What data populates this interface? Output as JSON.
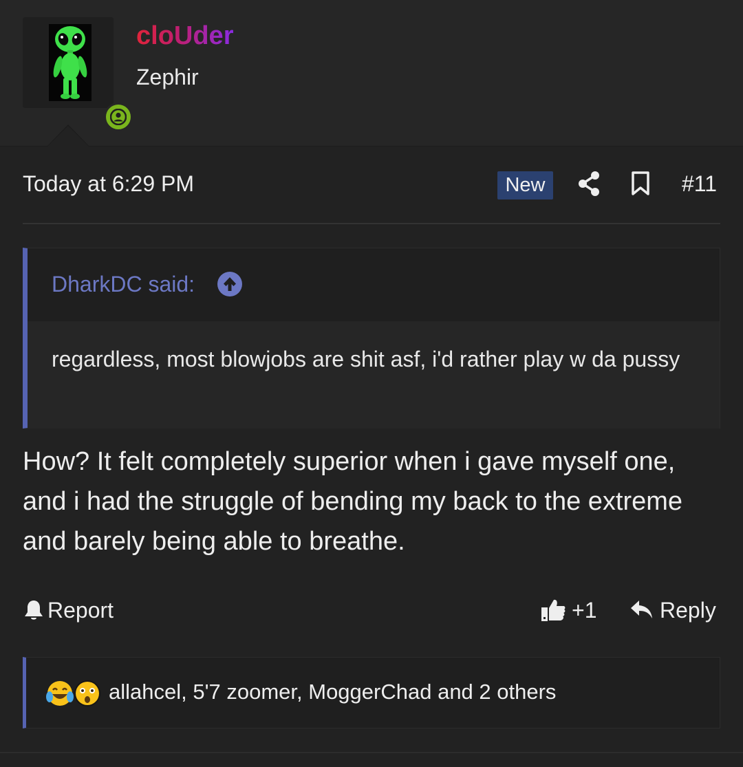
{
  "user": {
    "name": "cloUder",
    "title": "Zephir",
    "avatar_icon": "alien-avatar",
    "status_icon": "online-user-icon",
    "status_color": "#7ab51d",
    "name_gradient": [
      "#e0243a",
      "#8a2be2"
    ]
  },
  "post_meta": {
    "timestamp": "Today at 6:29 PM",
    "new_badge": "New",
    "share_icon": "share-icon",
    "bookmark_icon": "bookmark-icon",
    "post_number": "#11"
  },
  "quote": {
    "author": "DharkDC said:",
    "jump_icon": "arrow-up-circle-icon",
    "text": "regardless, most blowjobs are shit asf, i'd rather play w da pussy",
    "accent_color": "#5663b2"
  },
  "post": {
    "body": "How? It felt completely superior when i gave myself one, and i had the struggle of bending my back to the extreme and barely being able to breathe."
  },
  "actions": {
    "report_label": "Report",
    "report_icon": "bell-icon",
    "like_label": "+1",
    "like_icon": "thumbs-up-icon",
    "reply_label": "Reply",
    "reply_icon": "reply-arrow-icon"
  },
  "reactions": {
    "emojis": [
      "crying-laughing-emoji",
      "shocked-emoji"
    ],
    "users_text": "allahcel, 5'7 zoomer, MoggerChad and 2 others"
  }
}
